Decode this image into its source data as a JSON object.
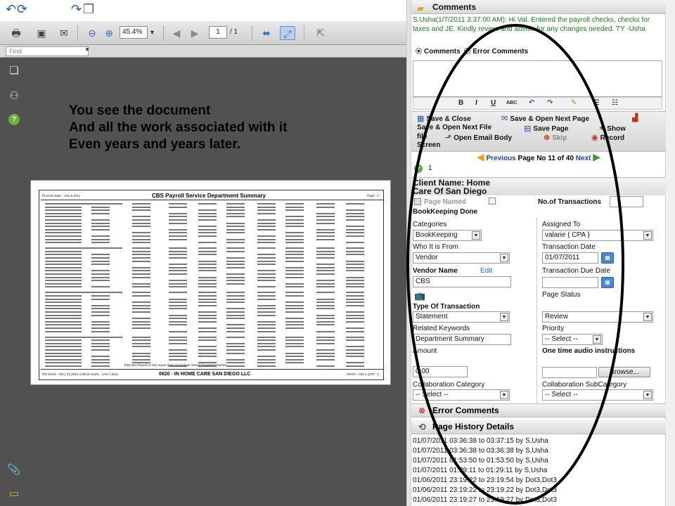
{
  "viewer": {
    "zoom": "45.4%",
    "page_current": "1",
    "page_total": "/ 1",
    "find_placeholder": "Find",
    "overlay_lines": [
      "You see the document",
      "And all the work associated with it",
      "Even years and years later."
    ]
  },
  "document": {
    "header_left": "Process Date - JAN 5,2011",
    "title": "CBS Payroll Service Department Summary",
    "page": "Page - 1",
    "footer_left": "P/E DATE - DEC 31,2010   CHECK DATE - JAN 7,2011",
    "footer_center": "0620 - IN HOME CARE SAN DIEGO LLC",
    "footer_right": "PROC - 001-1   QTR - 1",
    "note": "Total Net Payroll on this report does not include Vendor Payment Checks!"
  },
  "comments": {
    "title": "Comments",
    "author": "S,Usha(1/7/2011 3:37:00 AM):",
    "text": " Hi Val, Entered the payroll checks, checks for taxes and JE. Kindly review and advise for any changes needed. TY -Usha",
    "radio_comments": "Comments",
    "radio_errors": "Error Comments",
    "editor_buttons": [
      "B",
      "I",
      "U",
      "ABC"
    ]
  },
  "actions": {
    "save_close": "Save & Close",
    "save_open_next_page": "Save & Open Next Page",
    "save_open_next_file": "Save & Open Next File",
    "save_page": "Save Page",
    "show_file": "Show",
    "show_file_2": "file",
    "open_email": "Open Email Body",
    "skip": "Skip",
    "record": "Record",
    "record_2": "Screen"
  },
  "pager": {
    "prev": "Previous",
    "label": "Page No 11 of 40",
    "next": "Next",
    "count": "1"
  },
  "client": {
    "line1": "Client Name: Home",
    "line2": "Care Of San Diego",
    "page_named": "Page Named",
    "bookkeeping_done": "BookKeeping Done",
    "no_transactions_label": "No.of Transactions",
    "no_transactions_value": ""
  },
  "form": {
    "categories_label": "Categories",
    "categories_value": "BookKeeping",
    "assigned_label": "Assigned To",
    "assigned_value": "valarie ( CPA )",
    "who_label": "Who It is From",
    "who_value": "Vendor",
    "txn_date_label": "Transaction Date",
    "txn_date_value": "01/07/2011",
    "vendor_label": "Vendor Name",
    "vendor_edit": "Edit",
    "vendor_value": "CBS",
    "due_label": "Transaction Due Date",
    "due_value": "",
    "status_label": "Page Status",
    "status_value": "Review",
    "type_label": "Type Of Transaction",
    "type_value": "Statement",
    "keywords_label": "Related Keywords",
    "keywords_value": "Department Summary",
    "priority_label": "Priority",
    "priority_value": "-- Select --",
    "amount_label": "Amount",
    "amount_value": "0.00",
    "audio_label": "One time audio instructions",
    "browse_label": "Browse...",
    "collab_cat_label": "Collaboration Category",
    "collab_cat_value": "-- Select --",
    "collab_sub_label": "Collaboration SubCategory",
    "collab_sub_value": "-- Select --"
  },
  "errors": {
    "title": "Error Comments"
  },
  "history": {
    "title": "Page History Details",
    "rows": [
      "01/07/2011 03:36:38 to 03:37:15 by S,Usha",
      "01/07/2011 03:36:38 to 03:36:38 by S,Usha",
      "01/07/2011 01:53:50 to 01:53:50 by S,Usha",
      "01/07/2011 01:29:11 to 01:29:11 by S,Usha",
      "01/06/2011 23:19:22 to 23:19:54 by Dot3,Dot3",
      "01/06/2011 23:19:22 to 23:19:22 by Dot3,Dot3",
      "01/06/2011 23:19:27 to 23:19:27 by Dot3,Dot3"
    ]
  },
  "colors": {
    "viewer_bg": "#515151",
    "comment_green": "#1c7a1c",
    "link_blue": "#1e3fa8",
    "annotation": "#000000"
  }
}
